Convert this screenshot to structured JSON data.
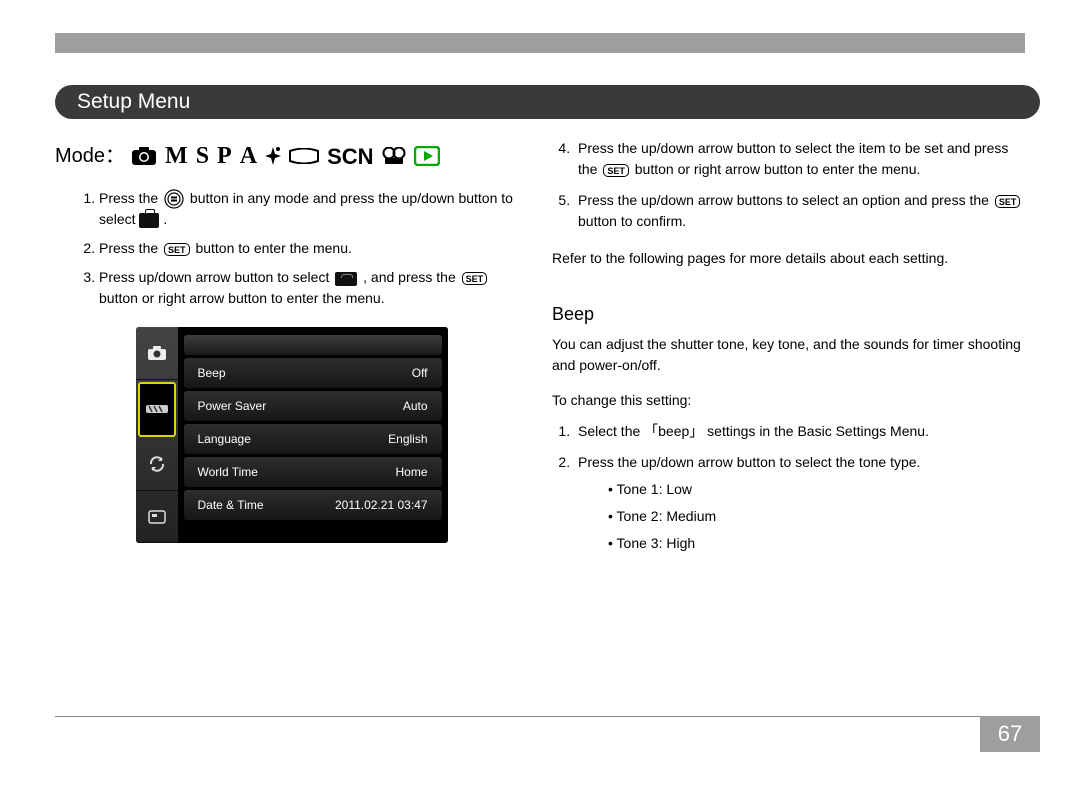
{
  "header": {
    "title": "Setup Menu"
  },
  "mode": {
    "label": "Mode：",
    "M": "M",
    "S": "S",
    "P": "P",
    "A": "A",
    "SCN": "SCN"
  },
  "left_steps": {
    "s1a": "Press the",
    "s1b": "button in any mode and press the up/down button to select",
    "s1c": ".",
    "s2a": "Press the",
    "s2b": "button to enter the menu.",
    "s3a": "Press up/down arrow button to select",
    "s3b": ", and press the",
    "s3c": "button or right arrow button to enter the menu."
  },
  "set_label": "SET",
  "camera_ui": {
    "rows": [
      {
        "label": "Beep",
        "value": "Off"
      },
      {
        "label": "Power Saver",
        "value": "Auto"
      },
      {
        "label": "Language",
        "value": "English"
      },
      {
        "label": "World Time",
        "value": "Home"
      },
      {
        "label": "Date & Time",
        "value": "2011.02.21 03:47"
      }
    ]
  },
  "right_steps": {
    "s4a": "Press the up/down arrow button to select the item to be set and press the",
    "s4b": "button or right arrow button to enter the menu.",
    "s5a": "Press the up/down arrow buttons to select an option and press the",
    "s5b": "button to confirm."
  },
  "refer": "Refer to the following pages for more details about each setting.",
  "beep": {
    "title": "Beep",
    "desc": "You can adjust the shutter tone, key tone, and the sounds for timer shooting and power-on/off.",
    "to_change": "To change this setting:",
    "step1": "Select the 「beep」 settings in the Basic Settings Menu.",
    "step2": "Press the up/down arrow button to select the tone type.",
    "tones": [
      "Tone 1: Low",
      "Tone 2: Medium",
      "Tone 3: High"
    ]
  },
  "page_number": "67"
}
